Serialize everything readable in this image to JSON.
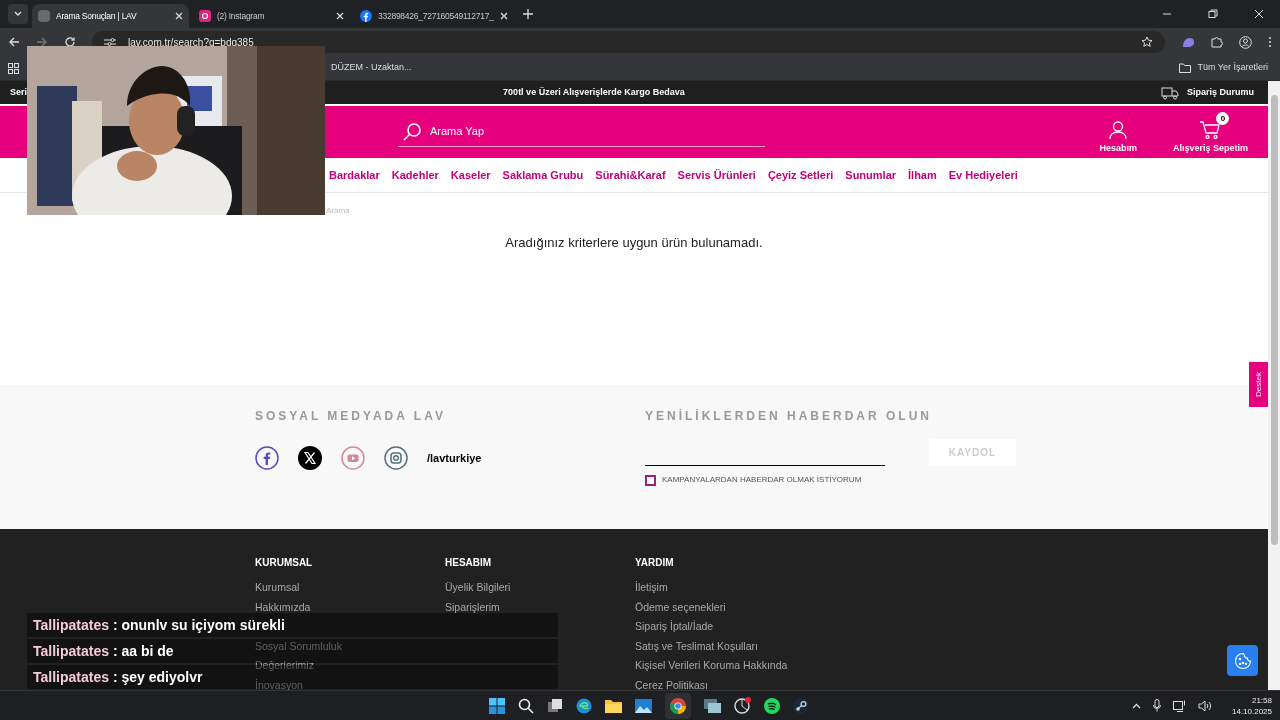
{
  "browser": {
    "tabs": [
      {
        "title": "Arama Sonuçları | LAV",
        "kind": "site",
        "selected": true
      },
      {
        "title": "(2) Instagram",
        "kind": "instagram",
        "selected": false
      },
      {
        "title": "332898426_727160549112717_",
        "kind": "facebook",
        "selected": false
      }
    ],
    "url": "lav.com.tr/search?q=bdq385",
    "bookmarks": [
      "DÜZEM - Uzaktan..."
    ],
    "all_bookmarks": "Tüm Yer İşaretleri"
  },
  "page": {
    "promo_bar": {
      "left": "Seri",
      "center": "700tl ve Üzeri Alışverişlerde Kargo Bedava",
      "right": "Sipariş Durumu"
    },
    "search": {
      "placeholder": "Arama Yap"
    },
    "header_actions": [
      {
        "kind": "account",
        "label": "Hesabım"
      },
      {
        "kind": "cart",
        "label": "Alışveriş Sepetim",
        "badge": "0"
      }
    ],
    "nav": [
      "Bardaklar",
      "Kadehler",
      "Kaseler",
      "Saklama Grubu",
      "Sürahi&Karaf",
      "Servis Ürünleri",
      "Çeyiz Setleri",
      "Sunumlar",
      "İlham",
      "Ev Hediyeleri"
    ],
    "breadcrumb": "Arama",
    "message": "Aradığınız kriterlere uygun ürün bulunamadı.",
    "side_tab": "Destek",
    "social": {
      "title": "SOSYAL MEDYADA LAV",
      "handle": "/lavturkiye"
    },
    "newsletter": {
      "title": "YENİLİKLERDEN HABERDAR OLUN",
      "button": "KAYDOL",
      "consent": "KAMPANYALARDAN HABERDAR OLMAK İSTİYORUM",
      "checked": false
    },
    "footer_columns": [
      {
        "title": "KURUMSAL",
        "links": [
          "Kurumsal",
          "Hakkımızda",
          "Sosyal Sorumluluk",
          "Değerlerimiz",
          "İnovasyon"
        ]
      },
      {
        "title": "HESABIM",
        "links": [
          "Üyelik Bilgileri",
          "Siparişlerim"
        ]
      },
      {
        "title": "YARDIM",
        "links": [
          "İletişim",
          "Ödeme seçenekleri",
          "Sipariş İptal/İade",
          "Satış ve Teslimat Koşulları",
          "Kişisel Verileri Koruma Hakkında",
          "Çerez Politikası"
        ]
      }
    ]
  },
  "chat": [
    {
      "user": "Tallipatates",
      "message": ": onunlv su içiyom sürekli"
    },
    {
      "user": "Tallipatates",
      "message": ": aa bi de"
    },
    {
      "user": "Tallipatates",
      "message": ": şey ediyolvr"
    }
  ],
  "taskbar": {
    "time": "21:58",
    "date": "14.10.2025"
  }
}
